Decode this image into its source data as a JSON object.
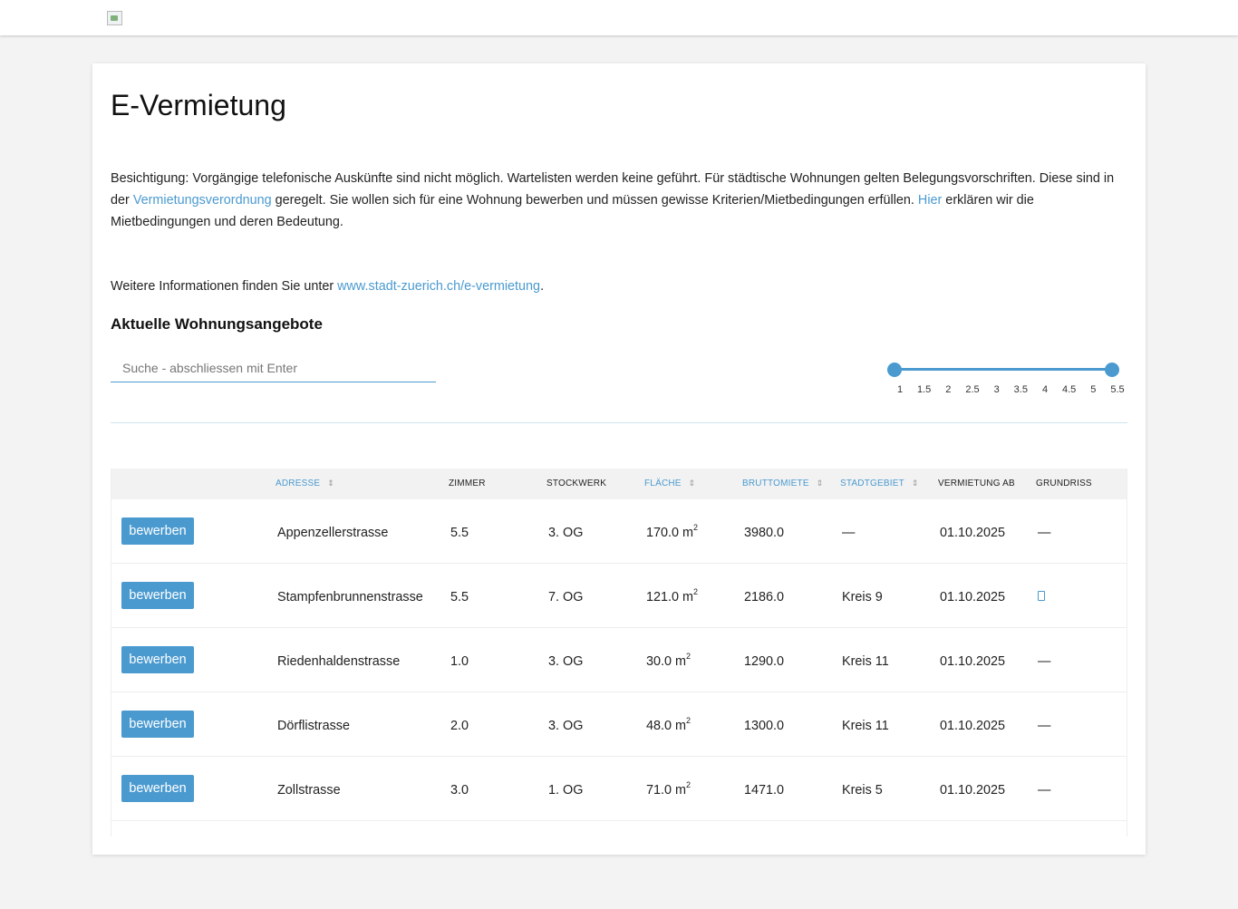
{
  "header": {
    "logo": "logo"
  },
  "page": {
    "title": "E-Vermietung",
    "intro_text_1": "Besichtigung: Vorgängige telefonische Auskünfte sind nicht möglich. Wartelisten werden keine geführt. Für städtische Wohnungen gelten Belegungsvorschriften. Diese sind in der ",
    "intro_link_1": "Vermietungsverordnung",
    "intro_text_2": " geregelt. Sie wollen sich für eine Wohnung bewerben und müssen gewisse Kriterien/Mietbedingungen erfüllen. ",
    "intro_link_2": "Hier",
    "intro_text_3": " erklären wir die Mietbedingungen und deren Bedeutung.",
    "more_text": "Weitere Informationen finden Sie unter ",
    "more_link": "www.stadt-zuerich.ch/e-vermietung",
    "more_end": ".",
    "subtitle": "Aktuelle Wohnungsangebote"
  },
  "search": {
    "placeholder": "Suche - abschliessen mit Enter",
    "value": ""
  },
  "slider": {
    "min": 1,
    "max": 5.5,
    "selected_min": 1,
    "selected_max": 5.5,
    "ticks": [
      "1",
      "1.5",
      "2",
      "2.5",
      "3",
      "3.5",
      "4",
      "4.5",
      "5",
      "5.5"
    ]
  },
  "table": {
    "headers": {
      "adresse": "ADRESSE",
      "zimmer": "ZIMMER",
      "stockwerk": "STOCKWERK",
      "flaeche": "FLÄCHE",
      "bruttomiete": "BRUTTOMIETE",
      "stadtgebiet": "STADTGEBIET",
      "vermietung": "VERMIETUNG AB",
      "grundriss": "GRUNDRISS"
    },
    "sort_icon": "",
    "button_label": "bewerben",
    "area_unit": "m",
    "area_exp": "2",
    "rows": [
      {
        "adresse": "Appenzellerstrasse",
        "zimmer": "5.5",
        "stockwerk": "3. OG",
        "flaeche": "170.0",
        "miete": "3980.0",
        "gebiet": "—",
        "ab": "01.10.2025",
        "grundriss": "—",
        "has_plan": false
      },
      {
        "adresse": "Stampfenbrunnenstrasse",
        "zimmer": "5.5",
        "stockwerk": "7. OG",
        "flaeche": "121.0",
        "miete": "2186.0",
        "gebiet": "Kreis 9",
        "ab": "01.10.2025",
        "grundriss": "",
        "has_plan": true
      },
      {
        "adresse": "Riedenhaldenstrasse",
        "zimmer": "1.0",
        "stockwerk": "3. OG",
        "flaeche": "30.0",
        "miete": "1290.0",
        "gebiet": "Kreis 11",
        "ab": "01.10.2025",
        "grundriss": "—",
        "has_plan": false
      },
      {
        "adresse": "Dörflistrasse",
        "zimmer": "2.0",
        "stockwerk": "3. OG",
        "flaeche": "48.0",
        "miete": "1300.0",
        "gebiet": "Kreis 11",
        "ab": "01.10.2025",
        "grundriss": "—",
        "has_plan": false
      },
      {
        "adresse": "Zollstrasse",
        "zimmer": "3.0",
        "stockwerk": "1. OG",
        "flaeche": "71.0",
        "miete": "1471.0",
        "gebiet": "Kreis 5",
        "ab": "01.10.2025",
        "grundriss": "—",
        "has_plan": false
      }
    ]
  },
  "colors": {
    "accent": "#4a9ad0",
    "background": "#f3f3f3",
    "header_row": "#f2f2f2"
  }
}
